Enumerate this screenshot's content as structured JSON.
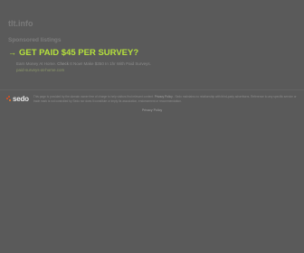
{
  "site": {
    "title": "tlt.info"
  },
  "sponsored": {
    "label": "Sponsored listings"
  },
  "ad": {
    "arrow": "→",
    "headline": "GET PAID $45 PER SURVEY?",
    "description_start": "Earn Money At Home. ",
    "description_highlight": "Check",
    "description_end": " It Now! Make $350 In 1hr With Paid Surveys.",
    "url": "paid-surveys-at-home.com"
  },
  "footer": {
    "logo_text": "sedo",
    "disclaimer_start": "This page is provided by the domain owner free of charge to help visitors find relevant content. ",
    "disclaimer_link": "Privacy Policy",
    "disclaimer_end": " - Sedo maintains no relationship with third-party advertisers. Reference to any specific service or trade mark is not controlled by Sedo nor does it constitute or imply its association, endorsement or recommendation."
  },
  "privacy": {
    "label": "Privacy Policy"
  },
  "colors": {
    "background": "#5a5a5a",
    "headline": "#b6e23c",
    "sedo_accent": "#e84f1c"
  }
}
